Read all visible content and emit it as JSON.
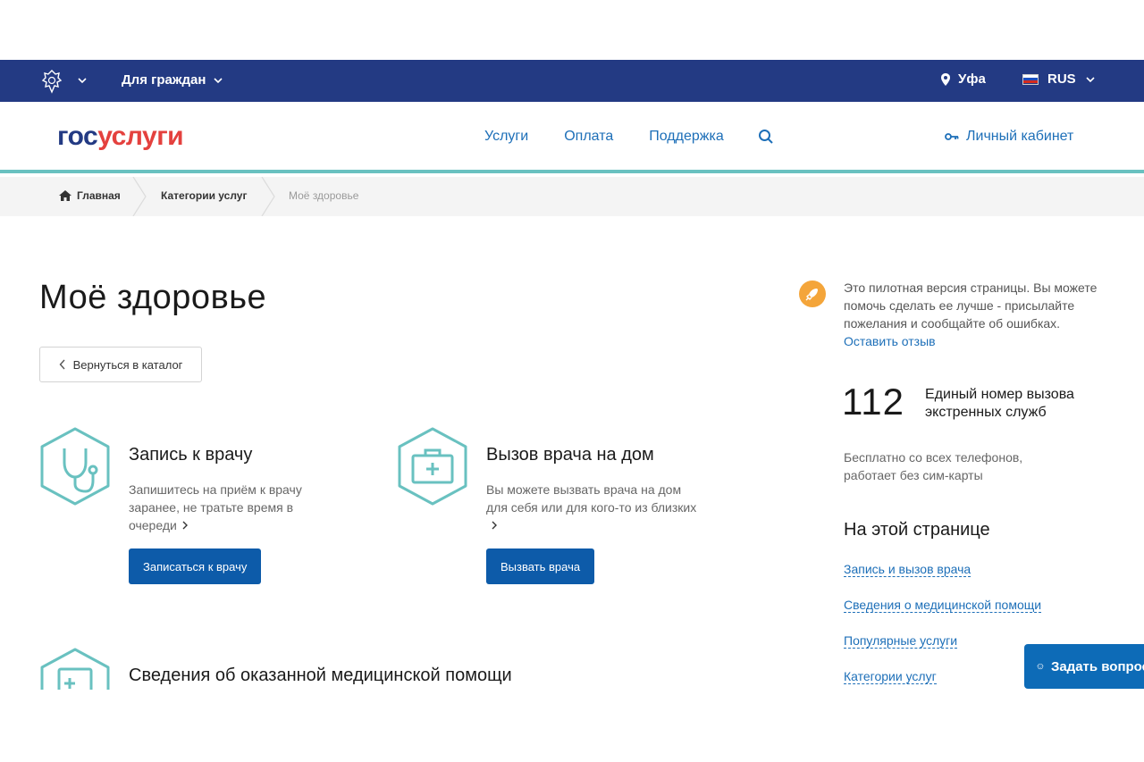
{
  "topbar": {
    "audience_label": "Для граждан",
    "city": "Уфа",
    "lang": "RUS"
  },
  "header": {
    "logo_gos": "гос",
    "logo_uslugi": "услуги",
    "nav": [
      "Услуги",
      "Оплата",
      "Поддержка"
    ],
    "cabinet_label": "Личный кабинет"
  },
  "breadcrumbs": [
    "Главная",
    "Категории услуг",
    "Моё здоровье"
  ],
  "page": {
    "title": "Моё здоровье",
    "back_label": "Вернуться в каталог"
  },
  "services": [
    {
      "title": "Запись к врачу",
      "desc": "Запишитесь на приём к врачу заранее, не тратьте время в очереди",
      "button": "Записаться к врачу",
      "icon": "stethoscope-icon"
    },
    {
      "title": "Вызов врача на дом",
      "desc": "Вы можете вызвать врача на дом для себя или для кого-то из близких",
      "button": "Вызвать врача",
      "icon": "medical-kit-icon"
    },
    {
      "title": "Сведения об оказанной медицинской помощи",
      "icon": "medical-record-icon"
    }
  ],
  "sidebar": {
    "note_text": "Это пилотная версия страницы. Вы можете помочь сделать ее лучше - присылайте пожелания и сообщайте об ошибках.",
    "note_link": "Оставить отзыв",
    "emergency_number": "112",
    "emergency_label": "Единый номер вызова экстренных служб",
    "emergency_desc": "Бесплатно со всех телефонов, работает без сим-карты",
    "toc_title": "На этой странице",
    "toc_links": [
      "Запись и вызов врача",
      "Сведения о медицинской помощи",
      "Популярные услуги",
      "Категории услуг"
    ]
  },
  "help_widget": {
    "label": "Задать вопрос"
  },
  "colors": {
    "topbar_bg": "#233a83",
    "accent_teal": "#69c1c0",
    "primary_button": "#0d5ba9",
    "link": "#1d6fb8",
    "logo_red": "#e4413e",
    "rocket_orange": "#f4a53a"
  }
}
